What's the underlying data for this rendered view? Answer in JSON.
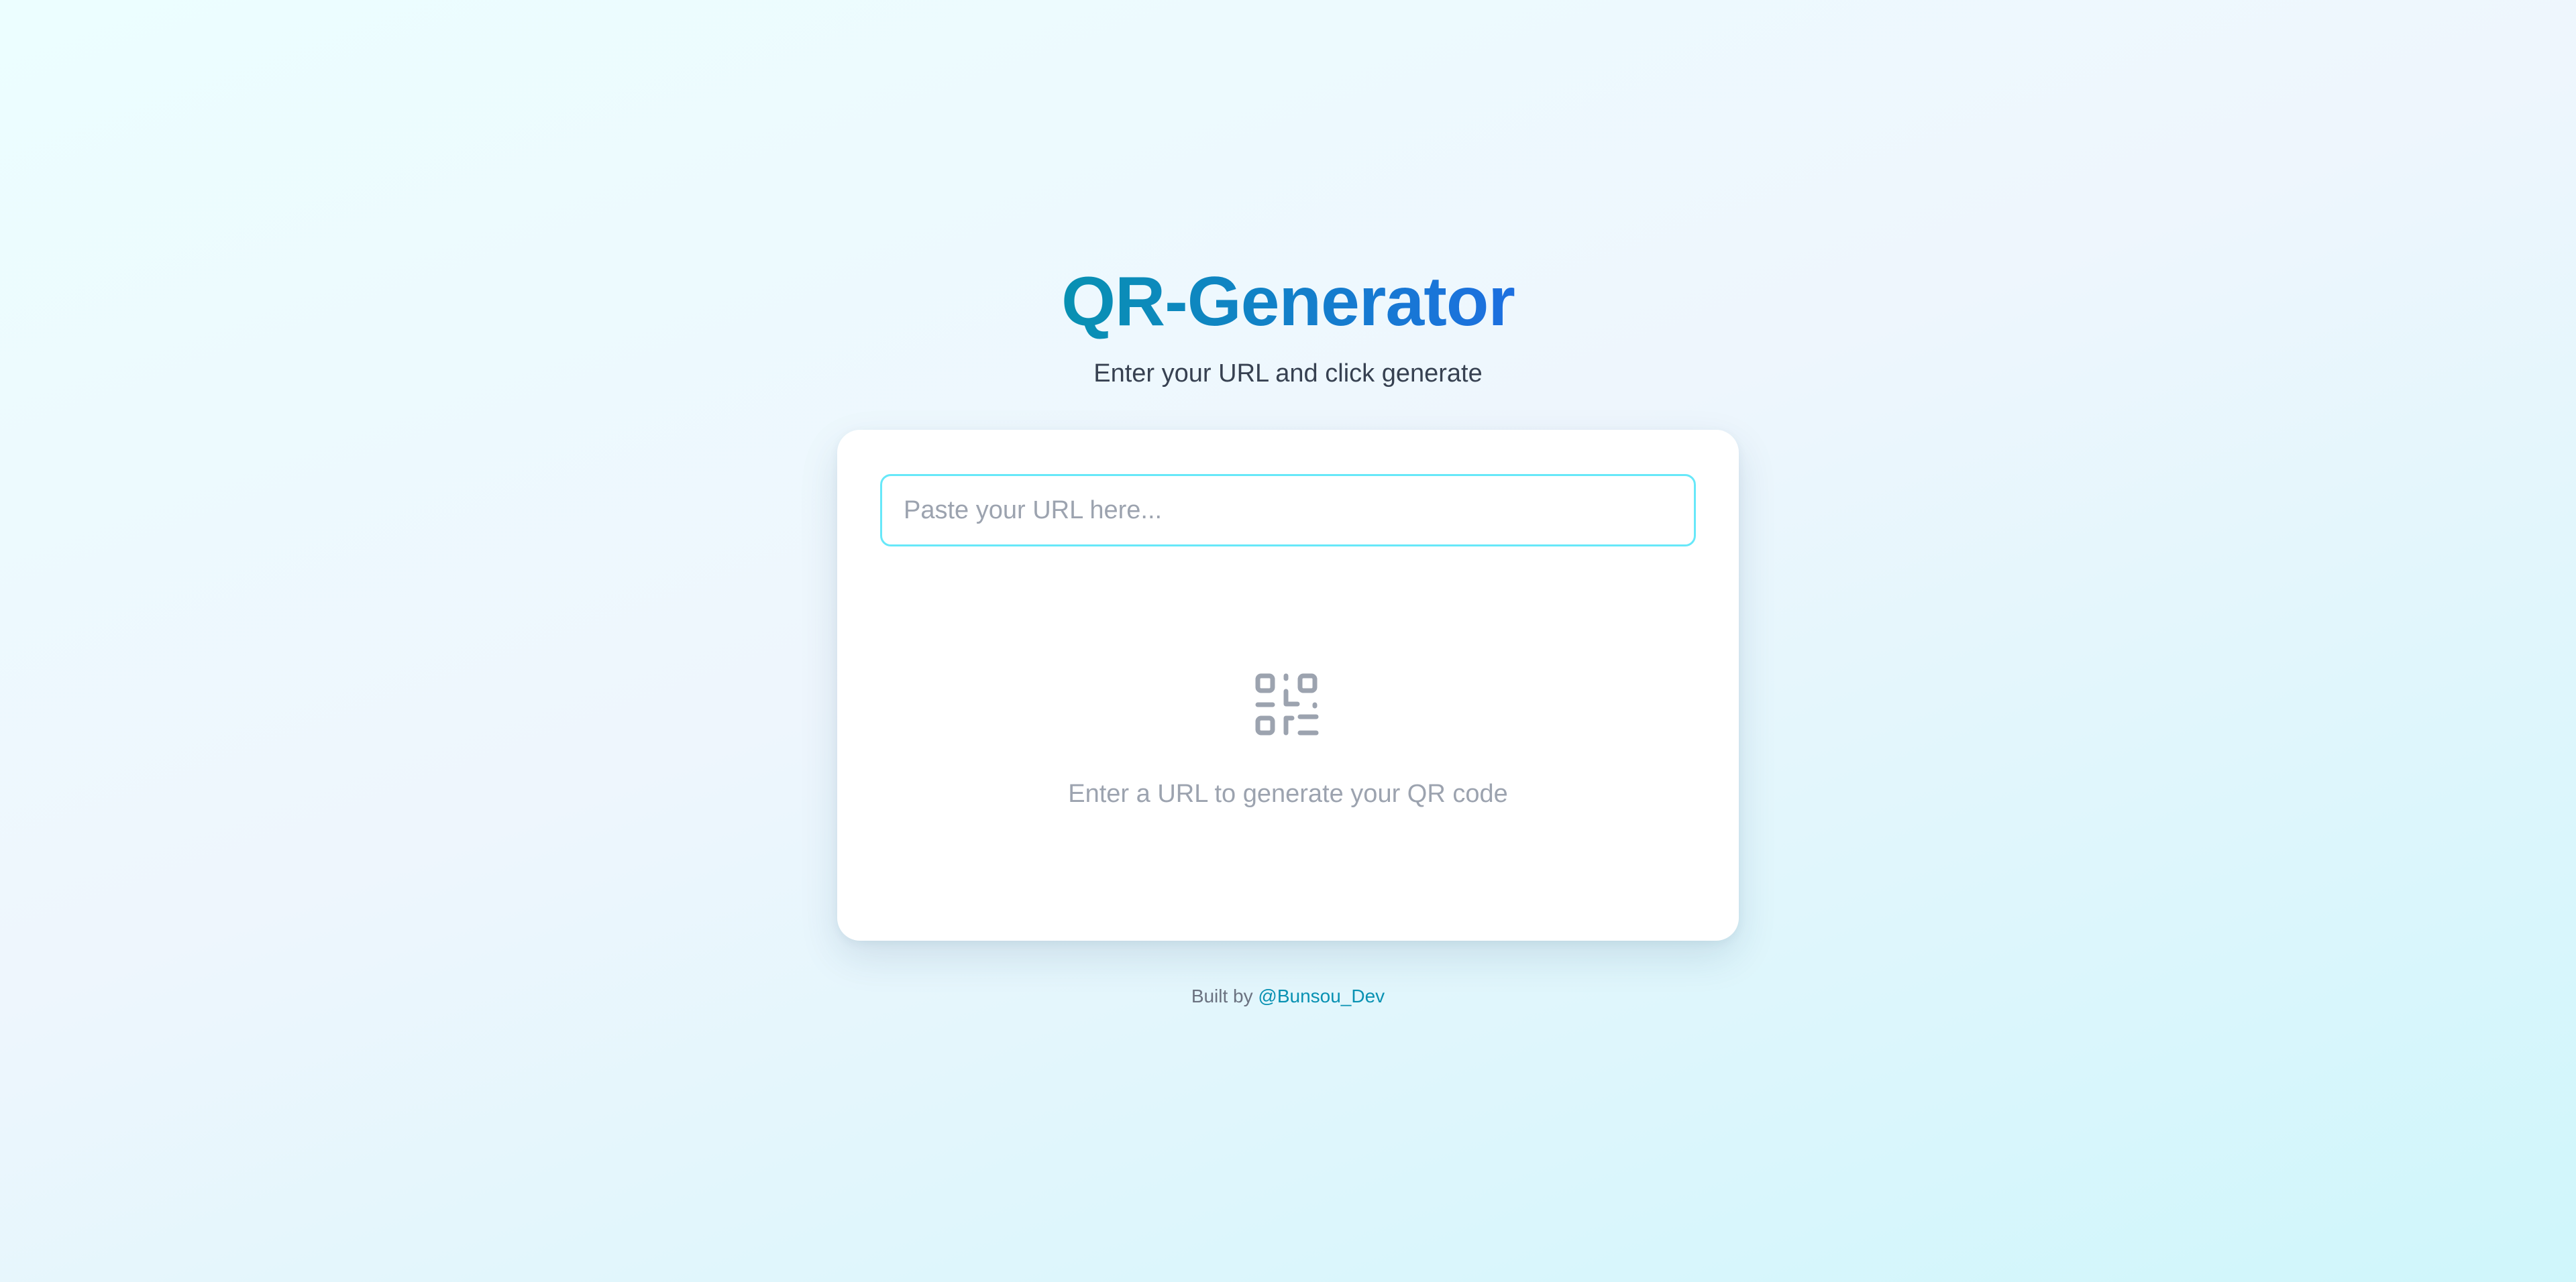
{
  "header": {
    "title": "QR-Generator",
    "subtitle": "Enter your URL and click generate"
  },
  "form": {
    "url_value": "",
    "url_placeholder": "Paste your URL here..."
  },
  "empty_state": {
    "icon": "qr-code-icon",
    "message": "Enter a URL to generate your QR code"
  },
  "footer": {
    "built_by_label": "Built by",
    "author_link": "@Bunsou_Dev"
  },
  "colors": {
    "title_gradient_start": "#0891b2",
    "title_gradient_end": "#1d6fe0",
    "input_border": "#67e8f9",
    "link": "#0891b2",
    "muted_text": "#9ca3af"
  }
}
